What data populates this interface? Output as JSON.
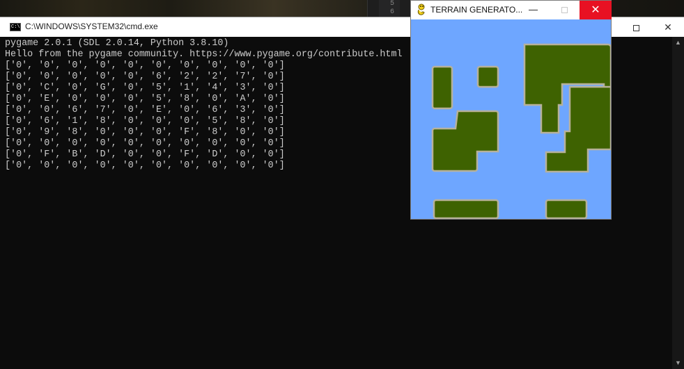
{
  "cmd": {
    "title": "C:\\WINDOWS\\SYSTEM32\\cmd.exe",
    "icon_text": "C:\\",
    "lines": [
      "pygame 2.0.1 (SDL 2.0.14, Python 3.8.10)",
      "Hello from the pygame community. https://www.pygame.org/contribute.html",
      "['0', '0', '0', '0', '0', '0', '0', '0', '0', '0']",
      "['0', '0', '0', '0', '0', '6', '2', '2', '7', '0']",
      "['0', 'C', '0', 'G', '0', '5', '1', '4', '3', '0']",
      "['0', 'E', '0', '0', '0', '5', '8', '0', 'A', '0']",
      "['0', '0', '6', '7', '0', 'E', '0', '6', '3', '0']",
      "['0', '6', '1', '8', '0', '0', '0', '5', '8', '0']",
      "['0', '9', '8', '0', '0', '0', 'F', '8', '0', '0']",
      "['0', '0', '0', '0', '0', '0', '0', '0', '0', '0']",
      "['0', 'F', 'B', 'D', '0', '0', 'F', 'D', '0', '0']",
      "['0', '0', '0', '0', '0', '0', '0', '0', '0', '0']"
    ]
  },
  "editor": {
    "line_numbers": [
      "5",
      "6"
    ]
  },
  "pygame_window": {
    "title": "TERRAIN GENERATO...",
    "icon": "snake-icon",
    "water_color": "#6ea6ff",
    "land_color": "#3e6201",
    "shore_color": "#b7b19a"
  },
  "icons": {
    "minimize": "minimize-icon",
    "maximize": "maximize-icon",
    "close": "close-icon"
  }
}
